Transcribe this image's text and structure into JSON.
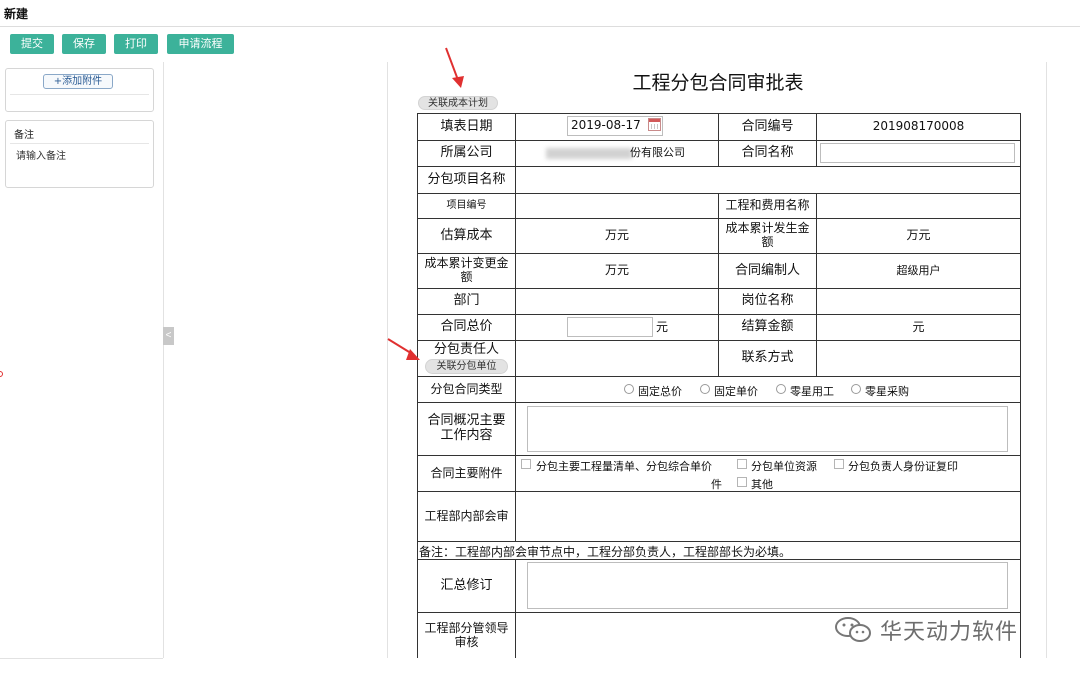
{
  "window": {
    "title": "新建"
  },
  "toolbar": {
    "submit": "提交",
    "save": "保存",
    "print": "打印",
    "flow": "申请流程"
  },
  "sidebar": {
    "add_attachment": "+添加附件",
    "remark_title": "备注",
    "remark_placeholder": "请输入备注"
  },
  "form": {
    "title": "工程分包合同审批表",
    "link_cost_plan": "关联成本计划",
    "link_sub_unit": "关联分包单位",
    "labels": {
      "fill_date": "填表日期",
      "contract_no": "合同编号",
      "company": "所属公司",
      "contract_name": "合同名称",
      "project_name": "分包项目名称",
      "project_no": "项目编号",
      "cost_item_name": "工程和费用名称",
      "estimated_cost": "估算成本",
      "cumulative_cost": "成本累计发生金额",
      "cumulative_change": "成本累计变更金额",
      "contract_author": "合同编制人",
      "department": "部门",
      "position": "岗位名称",
      "total_price": "合同总价",
      "settlement": "结算金额",
      "sub_leader": "分包责任人",
      "contact": "联系方式",
      "contract_type": "分包合同类型",
      "overview": "合同概况主要工作内容",
      "attachments": "合同主要附件",
      "internal_review": "工程部内部会审",
      "summary": "汇总修订",
      "leader_review": "工程部分管领导审核"
    },
    "values": {
      "fill_date": "2019-08-17",
      "contract_no": "201908170008",
      "company_suffix": "份有限公司",
      "estimated_cost_unit": "万元",
      "cumulative_cost_unit": "万元",
      "cumulative_change_unit": "万元",
      "contract_author": "超级用户",
      "total_price_unit": "元",
      "settlement_unit": "元"
    },
    "contract_types": [
      "固定总价",
      "固定单价",
      "零星用工",
      "零星采购"
    ],
    "attachment_options": [
      "分包主要工程量清单、分包综合单价件",
      "分包单位资源",
      "分包负责人身份证复印",
      "其他"
    ],
    "attachment_option1_line1": "分包主要工程量清单、分包综合单价",
    "attachment_option1_line2": "件",
    "note": "备注：工程部内部会审节点中，工程分部负责人，工程部部长为必填。"
  },
  "watermark": {
    "text": "华天动力软件",
    "icon": "wechat-icon"
  },
  "colors": {
    "toolbar_button": "#3cb29a",
    "annotation_arrow": "#e03030"
  }
}
